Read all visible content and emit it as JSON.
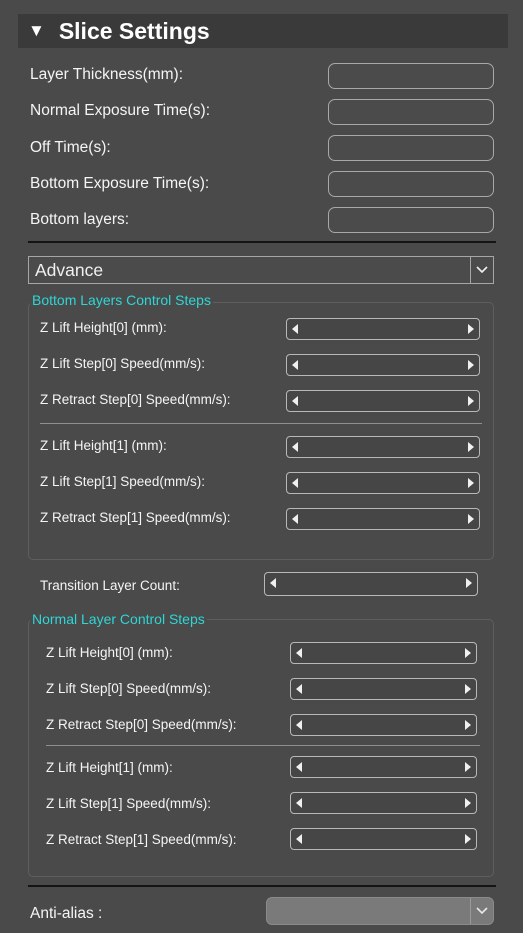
{
  "section": {
    "title": "Slice Settings"
  },
  "basic_fields": [
    {
      "label": "Layer Thickness(mm):",
      "value": ""
    },
    {
      "label": "Normal Exposure Time(s):",
      "value": ""
    },
    {
      "label": "Off Time(s):",
      "value": ""
    },
    {
      "label": "Bottom Exposure Time(s):",
      "value": ""
    },
    {
      "label": "Bottom layers:",
      "value": ""
    }
  ],
  "mode_select": {
    "value": "Advance"
  },
  "bottom_steps": {
    "title": "Bottom Layers Control Steps",
    "rows": [
      {
        "label": "Z Lift Height[0] (mm):"
      },
      {
        "label": "Z Lift Step[0] Speed(mm/s):"
      },
      {
        "label": "Z Retract Step[0] Speed(mm/s):"
      },
      {
        "label": "Z Lift Height[1] (mm):"
      },
      {
        "label": "Z Lift Step[1] Speed(mm/s):"
      },
      {
        "label": "Z Retract Step[1] Speed(mm/s):"
      }
    ]
  },
  "transition": {
    "label": "Transition Layer Count:"
  },
  "normal_steps": {
    "title": "Normal Layer Control Steps",
    "rows": [
      {
        "label": "Z Lift Height[0] (mm):"
      },
      {
        "label": "Z Lift Step[0] Speed(mm/s):"
      },
      {
        "label": "Z Retract Step[0] Speed(mm/s):"
      },
      {
        "label": "Z Lift Height[1] (mm):"
      },
      {
        "label": "Z Lift Step[1] Speed(mm/s):"
      },
      {
        "label": "Z Retract Step[1] Speed(mm/s):"
      }
    ]
  },
  "anti_alias": {
    "label": "Anti-alias :",
    "value": ""
  },
  "icons": {
    "collapse": "triangle-down-icon",
    "dropdown": "chevron-down-icon",
    "spin_left": "arrow-left-icon",
    "spin_right": "arrow-right-icon"
  }
}
